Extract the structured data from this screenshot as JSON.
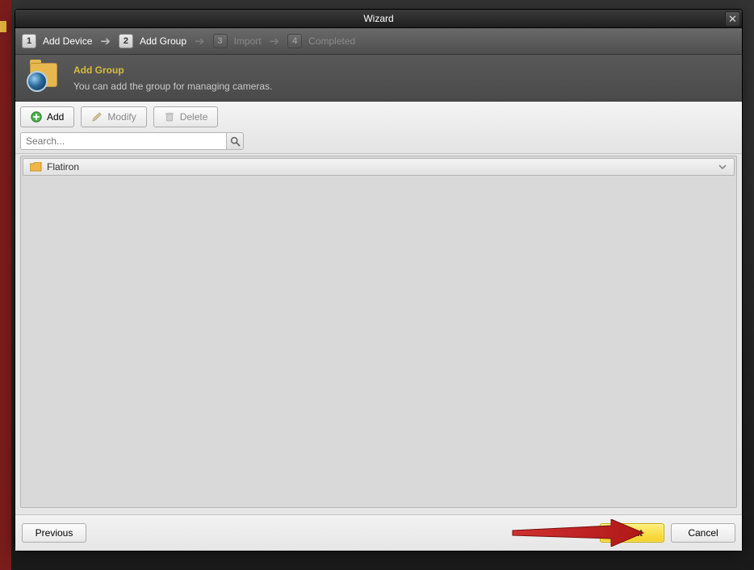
{
  "window": {
    "title": "Wizard"
  },
  "steps": {
    "items": [
      {
        "num": "1",
        "label": "Add Device",
        "state": "done"
      },
      {
        "num": "2",
        "label": "Add Group",
        "state": "active"
      },
      {
        "num": "3",
        "label": "Import",
        "state": "pending"
      },
      {
        "num": "4",
        "label": "Completed",
        "state": "pending"
      }
    ]
  },
  "info": {
    "heading": "Add Group",
    "subtext": "You can add the group for managing cameras."
  },
  "toolbar": {
    "add_label": "Add",
    "modify_label": "Modify",
    "delete_label": "Delete"
  },
  "search": {
    "placeholder": "Search..."
  },
  "group_list": {
    "items": [
      {
        "name": "Flatiron"
      }
    ]
  },
  "footer": {
    "previous_label": "Previous",
    "next_label": "Next",
    "cancel_label": "Cancel"
  },
  "icons": {
    "close": "close-icon",
    "add": "plus-circle-icon",
    "modify": "pencil-icon",
    "delete": "trash-icon",
    "search": "magnifier-icon",
    "folder": "folder-icon",
    "chevron_down": "chevron-down-icon",
    "arrow_right": "arrow-right-icon"
  }
}
